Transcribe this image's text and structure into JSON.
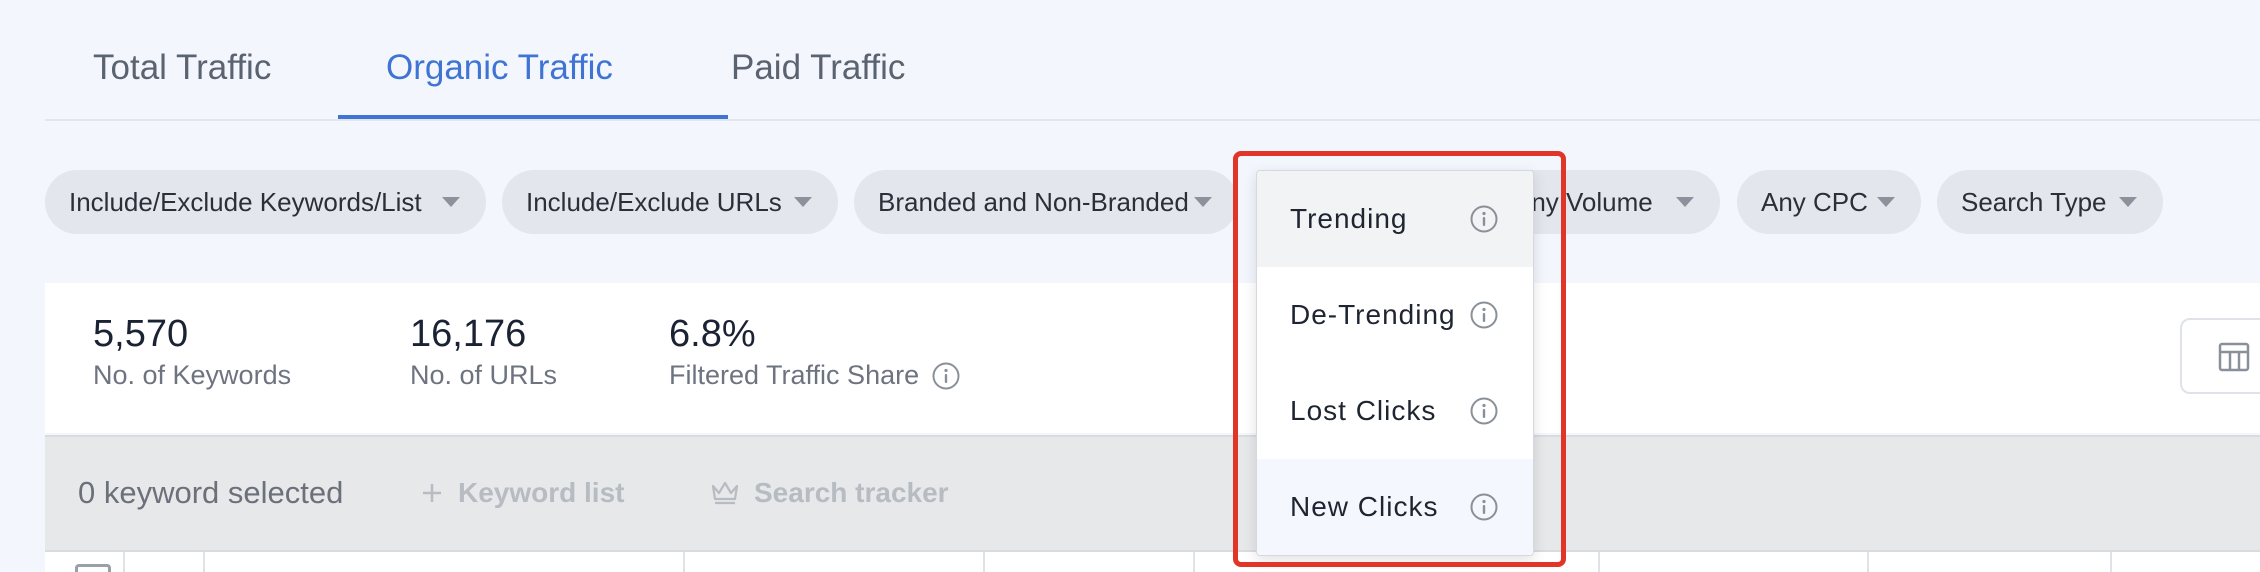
{
  "tabs": [
    {
      "label": "Total Traffic"
    },
    {
      "label": "Organic Traffic",
      "active": true
    },
    {
      "label": "Paid Traffic"
    }
  ],
  "filters": {
    "keywords": "Include/Exclude Keywords/List",
    "urls": "Include/Exclude URLs",
    "branded": "Branded and Non-Branded",
    "volume": "Any Volume",
    "cpc": "Any CPC",
    "search_type": "Search Type"
  },
  "stats": [
    {
      "value": "5,570",
      "label": "No. of Keywords"
    },
    {
      "value": "16,176",
      "label": "No. of URLs"
    },
    {
      "value": "6.8%",
      "label": "Filtered Traffic Share"
    }
  ],
  "action_bar": {
    "selected": "0 keyword selected",
    "keyword_list": "Keyword list",
    "search_tracker": "Search tracker"
  },
  "dropdown": {
    "items": [
      {
        "label": "Trending"
      },
      {
        "label": "De-Trending"
      },
      {
        "label": "Lost Clicks"
      },
      {
        "label": "New Clicks"
      }
    ]
  },
  "colors": {
    "accent": "#3f74d4",
    "highlight": "#e2352a"
  }
}
